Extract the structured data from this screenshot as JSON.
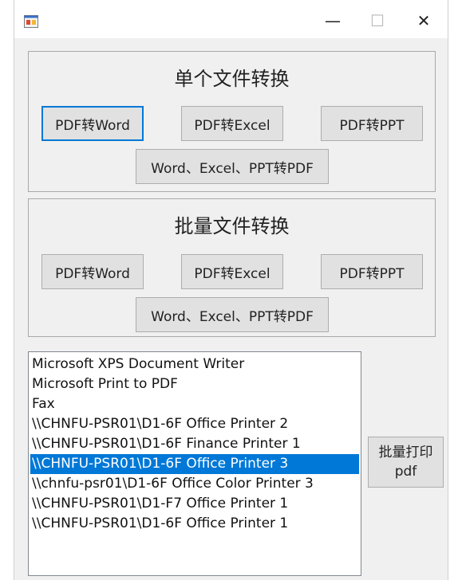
{
  "window": {
    "controls": {
      "minimize": "—",
      "maximize": "☐",
      "close": "✕"
    }
  },
  "single": {
    "title": "单个文件转换",
    "buttons": [
      "PDF转Word",
      "PDF转Excel",
      "PDF转PPT",
      "Word、Excel、PPT转PDF"
    ]
  },
  "batch": {
    "title": "批量文件转换",
    "buttons": [
      "PDF转Word",
      "PDF转Excel",
      "PDF转PPT",
      "Word、Excel、PPT转PDF"
    ]
  },
  "printers": {
    "items": [
      "Microsoft XPS Document Writer",
      "Microsoft Print to PDF",
      "Fax",
      "\\\\CHNFU-PSR01\\D1-6F Office Printer 2",
      "\\\\CHNFU-PSR01\\D1-6F Finance Printer 1",
      "\\\\CHNFU-PSR01\\D1-6F Office Printer 3",
      "\\\\chnfu-psr01\\D1-6F Office Color Printer 3",
      "\\\\CHNFU-PSR01\\D1-F7  Office Printer 1",
      "\\\\CHNFU-PSR01\\D1-6F Office Printer 1"
    ],
    "selected_index": 5
  },
  "print_button": {
    "label": "批量打印\npdf"
  },
  "colors": {
    "accent": "#0078d7",
    "button_bg": "#e1e1e1",
    "window_bg": "#f0f0f0"
  },
  "icons": {
    "app": "app-icon"
  }
}
